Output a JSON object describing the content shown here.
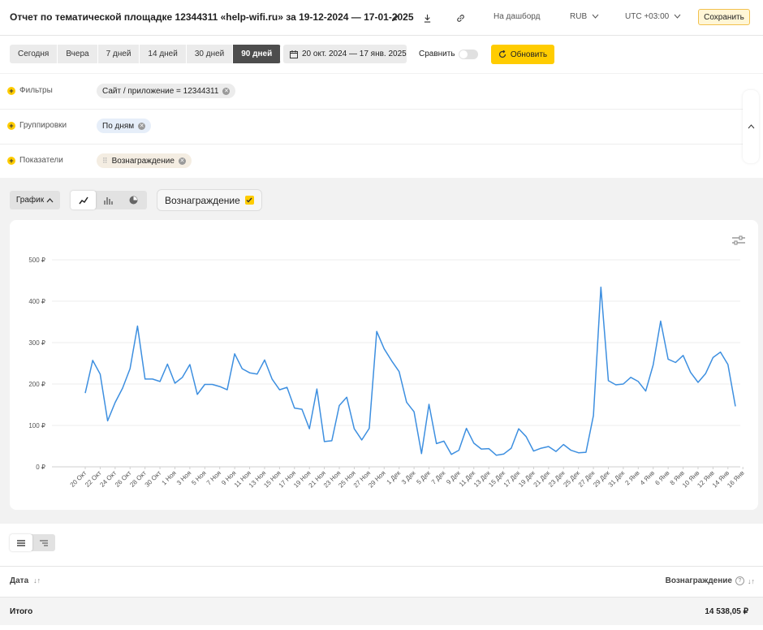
{
  "header": {
    "title": "Отчет по тематической площадке 12344311 «help-wifi.ru» за 19-12-2024 — 17-01-2025",
    "dashboard_label": "На дашборд",
    "currency_label": "RUB",
    "timezone_label": "UTC +03:00",
    "save_label": "Сохранить"
  },
  "toolbar": {
    "periods": [
      "Сегодня",
      "Вчера",
      "7 дней",
      "14 дней",
      "30 дней",
      "90 дней"
    ],
    "active_period": "90 дней",
    "date_range": "20 окт. 2024 — 17 янв. 2025",
    "compare_label": "Сравнить",
    "refresh_label": "Обновить"
  },
  "filters": {
    "filters_label": "Фильтры",
    "filter_chip": "Сайт / приложение = 12344311",
    "groupings_label": "Группировки",
    "grouping_chip": "По дням",
    "metrics_label": "Показатели",
    "metric_chip": "Вознаграждение"
  },
  "view": {
    "graph_label": "График",
    "metric_selected": "Вознаграждение"
  },
  "colors": {
    "accent": "#ffcc00",
    "line": "#3d8fe0",
    "active_period_bg": "#4d4d4d"
  },
  "table": {
    "col_date": "Дата",
    "col_reward": "Вознаграждение",
    "total_label": "Итого",
    "total_value": "14 538,05 ₽"
  },
  "chart_data": {
    "type": "line",
    "title": "",
    "xlabel": "",
    "ylabel": "",
    "ylim": [
      0,
      500
    ],
    "yticks": [
      "0 ₽",
      "100 ₽",
      "200 ₽",
      "300 ₽",
      "400 ₽",
      "500 ₽"
    ],
    "grid": true,
    "tick_labels": [
      "20 Окт",
      "22 Окт",
      "24 Окт",
      "26 Окт",
      "28 Окт",
      "30 Окт",
      "1 Ноя",
      "3 Ноя",
      "5 Ноя",
      "7 Ноя",
      "9 Ноя",
      "11 Ноя",
      "13 Ноя",
      "15 Ноя",
      "17 Ноя",
      "19 Ноя",
      "21 Ноя",
      "23 Ноя",
      "25 Ноя",
      "27 Ноя",
      "29 Ноя",
      "1 Дек",
      "3 Дек",
      "5 Дек",
      "7 Дек",
      "9 Дек",
      "11 Дек",
      "13 Дек",
      "15 Дек",
      "17 Дек",
      "19 Дек",
      "21 Дек",
      "23 Дек",
      "25 Дек",
      "27 Дек",
      "29 Дек",
      "31 Дек",
      "2 Янв",
      "4 Янв",
      "6 Янв",
      "8 Янв",
      "10 Янв",
      "12 Янв",
      "14 Янв",
      "16 Янв"
    ],
    "series": [
      {
        "name": "Вознаграждение",
        "values": [
          178,
          257,
          224,
          111,
          155,
          190,
          237,
          340,
          212,
          212,
          206,
          248,
          202,
          216,
          247,
          175,
          199,
          199,
          194,
          186,
          273,
          237,
          227,
          224,
          258,
          212,
          186,
          192,
          142,
          139,
          92,
          188,
          61,
          63,
          148,
          168,
          92,
          65,
          93,
          327,
          285,
          256,
          230,
          156,
          133,
          32,
          151,
          56,
          62,
          30,
          40,
          93,
          57,
          43,
          44,
          28,
          31,
          45,
          92,
          73,
          38,
          45,
          49,
          37,
          54,
          40,
          34,
          35,
          124,
          434,
          208,
          198,
          200,
          216,
          206,
          183,
          246,
          352,
          260,
          252,
          269,
          228,
          204,
          225,
          264,
          277,
          247,
          146
        ]
      }
    ]
  }
}
